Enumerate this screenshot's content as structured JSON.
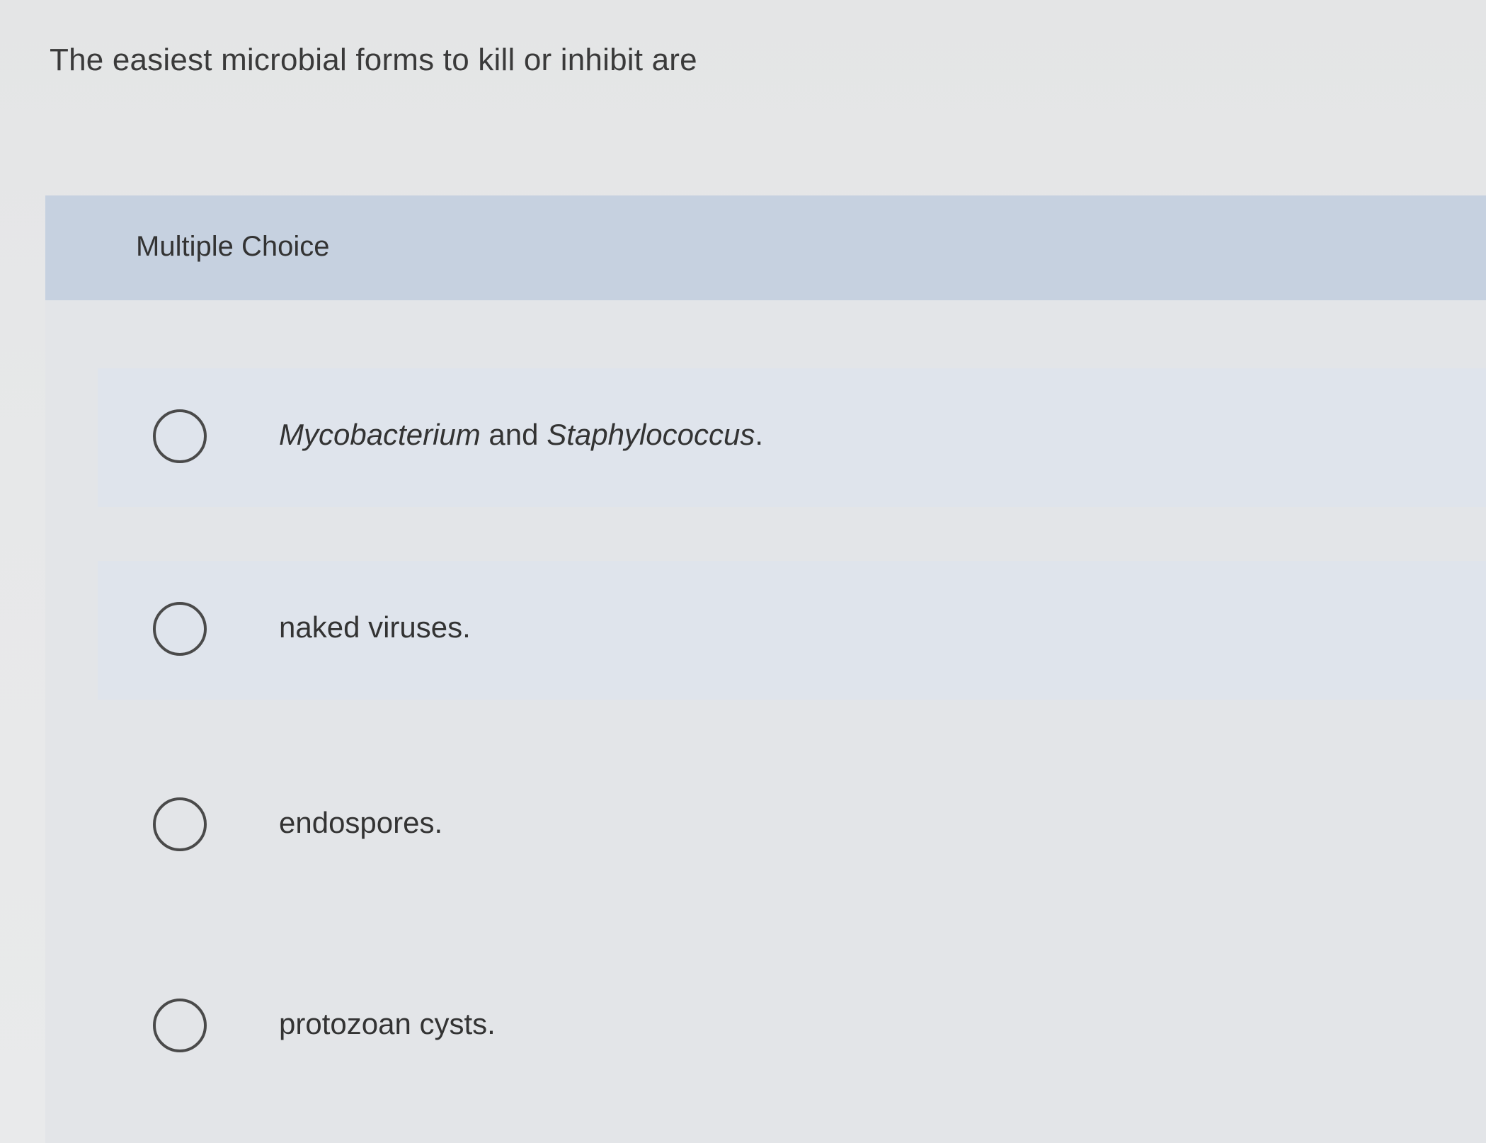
{
  "question": {
    "text": "The easiest microbial forms to kill or inhibit are"
  },
  "section": {
    "type_label": "Multiple Choice"
  },
  "options": [
    {
      "italic_1": "Mycobacterium",
      "connector": " and ",
      "italic_2": "Staphylococcus",
      "suffix": ".",
      "selected": false
    },
    {
      "label": "naked viruses.",
      "selected": false
    },
    {
      "label": "endospores.",
      "selected": false
    },
    {
      "label": "protozoan cysts.",
      "selected": false
    }
  ]
}
